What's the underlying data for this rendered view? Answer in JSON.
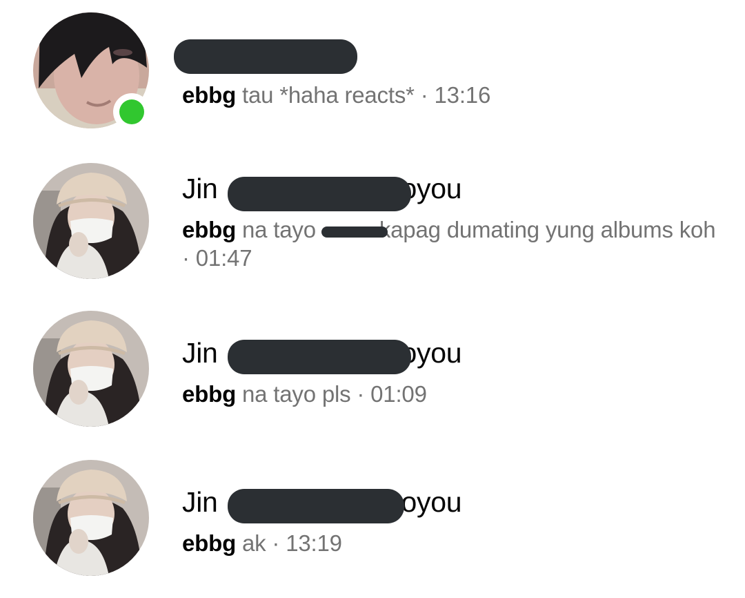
{
  "chats": [
    {
      "name_prefix": "",
      "name_suffix": "",
      "online": true,
      "sender": "ebbg",
      "message": "tau *haha reacts*",
      "separator": " · ",
      "time": "13:16"
    },
    {
      "name_prefix": "Jin",
      "name_suffix": "oyou",
      "online": false,
      "sender": "ebbg",
      "message": "na tayo",
      "message_after_redaction": "kapag dumating yung albums koh",
      "separator": " · ",
      "time": "01:47"
    },
    {
      "name_prefix": "Jin",
      "name_suffix": "oyou",
      "online": false,
      "sender": "ebbg",
      "message": "na tayo pls",
      "separator": " · ",
      "time": "01:09"
    },
    {
      "name_prefix": "Jin",
      "name_suffix": "oyou",
      "online": false,
      "sender": "ebbg",
      "message": "ak",
      "separator": " · ",
      "time": "13:19"
    }
  ],
  "colors": {
    "online": "#31c72f",
    "redaction": "#2b2f33",
    "primary_text": "#050505",
    "secondary_text": "#737373"
  }
}
